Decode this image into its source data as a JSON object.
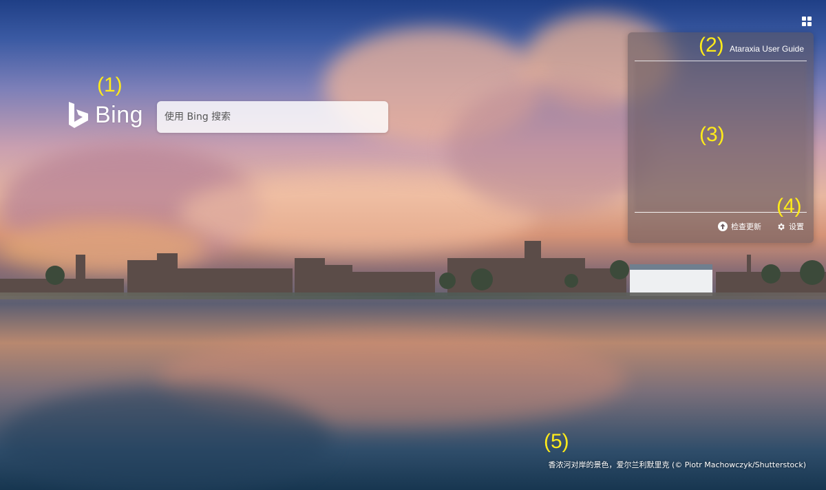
{
  "brand": {
    "name": "Bing",
    "color": "#ffffff"
  },
  "search": {
    "placeholder": "使用 Bing 搜索"
  },
  "top_right": {
    "icon": "apps-grid-icon"
  },
  "panel": {
    "title": "Ataraxia User Guide",
    "actions": [
      {
        "label": "检查更新",
        "icon": "upload-arrow-icon"
      },
      {
        "label": "设置",
        "icon": "gear-icon"
      }
    ]
  },
  "annotations": {
    "m1": "(1)",
    "m2": "(2)",
    "m3": "(3)",
    "m4": "(4)",
    "m5": "(5)",
    "color": "#ffeb1a"
  },
  "caption": "香浓河对岸的景色，爱尔兰利默里克 (© Piotr Machowczyk/Shutterstock)"
}
